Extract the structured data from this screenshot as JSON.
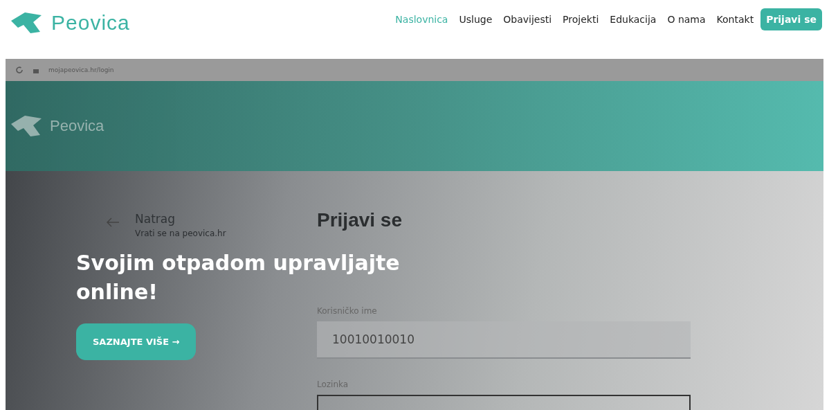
{
  "brand": {
    "name": "Peovica"
  },
  "nav": {
    "items": [
      {
        "label": "Naslovnica",
        "selected": true
      },
      {
        "label": "Usluge",
        "selected": false
      },
      {
        "label": "Obavijesti",
        "selected": false
      },
      {
        "label": "Projekti",
        "selected": false
      },
      {
        "label": "Edukacija",
        "selected": false
      },
      {
        "label": "O nama",
        "selected": false
      },
      {
        "label": "Kontakt",
        "selected": false
      }
    ],
    "login_button": "Prijavi se"
  },
  "hero": {
    "screenshot": {
      "address": "mojapeovica.hr/login",
      "brand": "Peovica",
      "back": {
        "label": "Natrag",
        "sublabel": "Vrati se na peovica.hr"
      },
      "form": {
        "title": "Prijavi se",
        "fields": [
          {
            "label": "Korisničko ime",
            "value": "10010010010",
            "kind": "filled"
          },
          {
            "label": "Lozinka",
            "kind": "outlined"
          }
        ]
      }
    },
    "headline": "Svojim otpadom upravljajte online!",
    "cta": "SAZNAJTE VIŠE →"
  }
}
